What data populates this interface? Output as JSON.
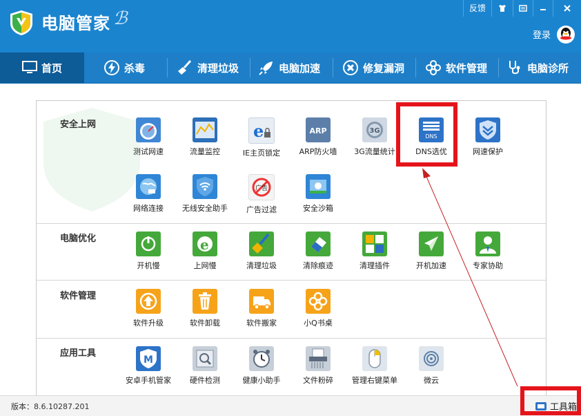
{
  "app": {
    "title": "电脑管家",
    "login_label": "登录"
  },
  "window_controls": {
    "feedback": "反馈"
  },
  "nav": [
    {
      "label": "首页",
      "icon": "monitor-icon"
    },
    {
      "label": "杀毒",
      "icon": "lightning-icon"
    },
    {
      "label": "清理垃圾",
      "icon": "broom-icon"
    },
    {
      "label": "电脑加速",
      "icon": "rocket-icon"
    },
    {
      "label": "修复漏洞",
      "icon": "patch-icon"
    },
    {
      "label": "软件管理",
      "icon": "flower-icon"
    },
    {
      "label": "电脑诊所",
      "icon": "stethoscope-icon"
    }
  ],
  "sections": [
    {
      "title": "安全上网",
      "tools": [
        "测试网速",
        "流量监控",
        "IE主页锁定",
        "ARP防火墙",
        "3G流量统计",
        "DNS选优",
        "网速保护",
        "网络连接",
        "无线安全助手",
        "广告过滤",
        "安全沙箱"
      ]
    },
    {
      "title": "电脑优化",
      "tools": [
        "开机慢",
        "上网慢",
        "清理垃圾",
        "清除痕迹",
        "清理插件",
        "开机加速",
        "专家协助"
      ]
    },
    {
      "title": "软件管理",
      "tools": [
        "软件升级",
        "软件卸载",
        "软件搬家",
        "小Q书桌"
      ]
    },
    {
      "title": "应用工具",
      "tools": [
        "安卓手机管家",
        "硬件检测",
        "健康小助手",
        "文件粉碎",
        "管理右键菜单",
        "微云"
      ]
    }
  ],
  "icon_texts": {
    "arp": "ARP",
    "g3": "3G",
    "dns": "DNS",
    "ad": "广告"
  },
  "status": {
    "version": "版本：8.6.10287.201",
    "toolbox": "工具箱"
  },
  "colors": {
    "brand_blue": "#1b84cf",
    "nav_active": "#0d5b97",
    "highlight_red": "#e5141b"
  }
}
